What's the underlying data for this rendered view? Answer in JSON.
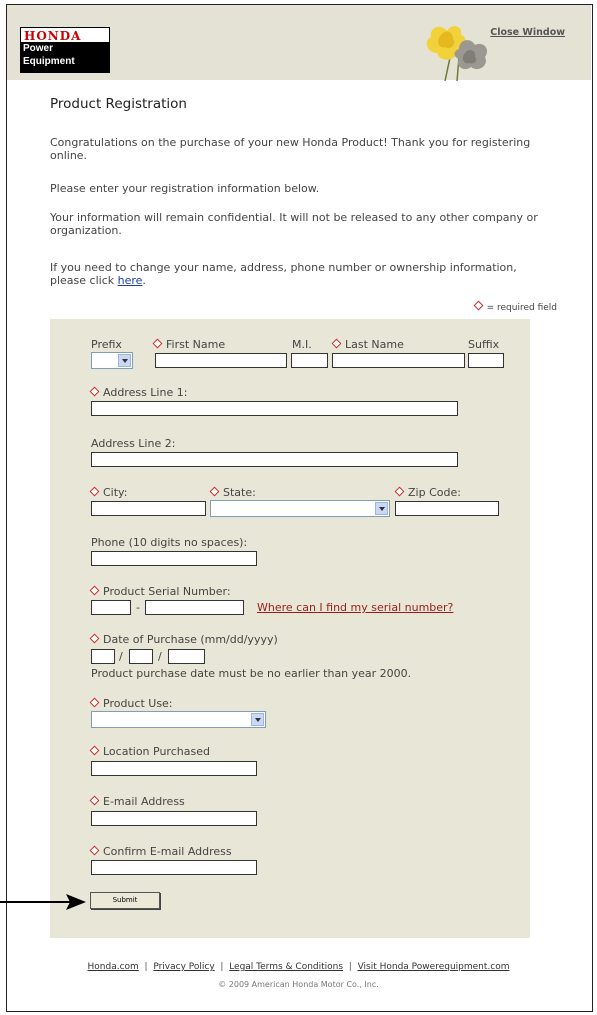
{
  "header": {
    "logo": {
      "line1": "HONDA",
      "line2": "Power",
      "line3": "Equipment"
    },
    "close_window": "Close Window",
    "colors": {
      "header_bg": "#e4e2d4",
      "brand_red": "#cc0000"
    }
  },
  "content": {
    "title": "Product Registration",
    "p1": "Congratulations on the purchase of your new Honda Product! Thank you for registering online.",
    "p2": "Please enter your registration information below.",
    "p3": "Your information will remain confidential. It will not be released to any other company or organization.",
    "p4_prefix": "If you need to change your name, address, phone number or ownership information, please click ",
    "p4_link": "here",
    "p4_suffix": ".",
    "required_note": "= required field"
  },
  "form": {
    "prefix_label": "Prefix",
    "first_name_label": "First Name",
    "mi_label": "M.I.",
    "last_name_label": "Last Name",
    "suffix_label": "Suffix",
    "address1_label": "Address Line 1:",
    "address2_label": "Address Line 2:",
    "city_label": "City:",
    "state_label": "State:",
    "zip_label": "Zip Code:",
    "phone_label": "Phone (10 digits no spaces):",
    "serial_label": "Product Serial Number:",
    "serial_dash": "-",
    "serial_help_link": "Where can I find my serial number?",
    "date_label": "Date of Purchase (mm/dd/yyyy)",
    "date_slash": "/",
    "date_note": "Product purchase date must be no earlier than year 2000.",
    "product_use_label": "Product Use:",
    "location_label": "Location Purchased",
    "email_label": "E-mail Address",
    "confirm_email_label": "Confirm E-mail Address",
    "submit_label": "Submit"
  },
  "footer": {
    "links": [
      "Honda.com",
      "Privacy Policy",
      "Legal Terms & Conditions",
      "Visit Honda Powerequipment.com"
    ],
    "separator": "|",
    "copyright": "© 2009 American Honda Motor Co., Inc."
  }
}
